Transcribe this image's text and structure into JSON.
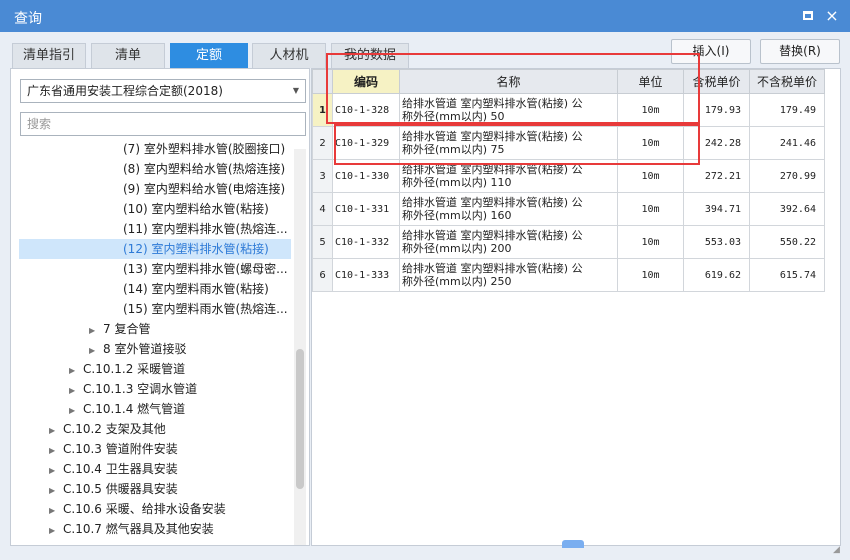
{
  "window": {
    "title": "查询",
    "maximize_icon": "maximize-icon",
    "close_icon": "close-icon",
    "close_glyph": "×"
  },
  "tabs": [
    {
      "label": "清单指引"
    },
    {
      "label": "清单"
    },
    {
      "label": "定额",
      "active": true
    },
    {
      "label": "人材机"
    },
    {
      "label": "我的数据"
    }
  ],
  "actions": {
    "insert": "插入(I)",
    "replace": "替换(R)"
  },
  "left": {
    "library": "广东省通用安装工程综合定额(2018)",
    "search_placeholder": "搜索",
    "tree": [
      {
        "label": "(7) 室外塑料排水管(胶圈接口)"
      },
      {
        "label": "(8) 室内塑料给水管(热熔连接)"
      },
      {
        "label": "(9) 室内塑料给水管(电熔连接)"
      },
      {
        "label": "(10) 室内塑料给水管(粘接)"
      },
      {
        "label": "(11) 室内塑料排水管(热熔连..."
      },
      {
        "label": "(12) 室内塑料排水管(粘接)",
        "selected": true
      },
      {
        "label": "(13) 室内塑料排水管(螺母密..."
      },
      {
        "label": "(14) 室内塑料雨水管(粘接)"
      },
      {
        "label": "(15) 室内塑料雨水管(热熔连..."
      },
      {
        "label": "7 复合管",
        "arrow": "▶"
      },
      {
        "label": "8 室外管道接驳",
        "arrow": "▶"
      },
      {
        "label": "C.10.1.2 采暖管道",
        "arrow": "▶"
      },
      {
        "label": "C.10.1.3 空调水管道",
        "arrow": "▶"
      },
      {
        "label": "C.10.1.4 燃气管道",
        "arrow": "▶"
      },
      {
        "label": "C.10.2 支架及其他",
        "arrow": "▶"
      },
      {
        "label": "C.10.3 管道附件安装",
        "arrow": "▶"
      },
      {
        "label": "C.10.4 卫生器具安装",
        "arrow": "▶"
      },
      {
        "label": "C.10.5 供暖器具安装",
        "arrow": "▶"
      },
      {
        "label": "C.10.6 采暖、给排水设备安装",
        "arrow": "▶"
      },
      {
        "label": "C.10.7 燃气器具及其他安装",
        "arrow": "▶"
      }
    ]
  },
  "table": {
    "headers": {
      "code": "编码",
      "name": "名称",
      "unit": "单位",
      "tax_price": "含税单价",
      "notax_price": "不含税单价"
    },
    "rows": [
      {
        "num": "1",
        "code": "C10-1-328",
        "name1": "给排水管道 室内塑料排水管(粘接) 公",
        "name2": "称外径(mm以内) 50",
        "unit": "10m",
        "tax": "179.93",
        "notax": "179.49"
      },
      {
        "num": "2",
        "code": "C10-1-329",
        "name1": "给排水管道 室内塑料排水管(粘接) 公",
        "name2": "称外径(mm以内) 75",
        "unit": "10m",
        "tax": "242.28",
        "notax": "241.46"
      },
      {
        "num": "3",
        "code": "C10-1-330",
        "name1": "给排水管道 室内塑料排水管(粘接) 公",
        "name2": "称外径(mm以内) 110",
        "unit": "10m",
        "tax": "272.21",
        "notax": "270.99"
      },
      {
        "num": "4",
        "code": "C10-1-331",
        "name1": "给排水管道 室内塑料排水管(粘接) 公",
        "name2": "称外径(mm以内) 160",
        "unit": "10m",
        "tax": "394.71",
        "notax": "392.64"
      },
      {
        "num": "5",
        "code": "C10-1-332",
        "name1": "给排水管道 室内塑料排水管(粘接) 公",
        "name2": "称外径(mm以内) 200",
        "unit": "10m",
        "tax": "553.03",
        "notax": "550.22"
      },
      {
        "num": "6",
        "code": "C10-1-333",
        "name1": "给排水管道 室内塑料排水管(粘接) 公",
        "name2": "称外径(mm以内) 250",
        "unit": "10m",
        "tax": "619.62",
        "notax": "615.74"
      }
    ]
  },
  "colors": {
    "titlebar": "#4a8ad4",
    "active_tab": "#2e8de1",
    "highlight": "#e83a3a",
    "selected_tree": "#cfe6fb"
  }
}
